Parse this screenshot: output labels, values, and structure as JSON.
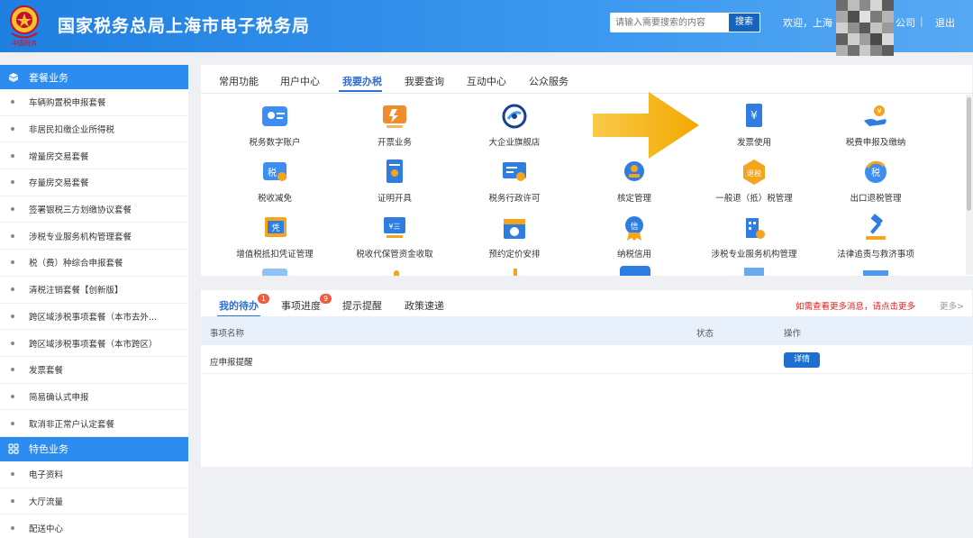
{
  "header": {
    "site_title": "国家税务总局上海市电子税务局",
    "search_placeholder": "请输入需要搜索的内容",
    "search_button": "搜索",
    "welcome": "欢迎，上海",
    "company_suffix": "公司",
    "separator": "|",
    "logout": "退出",
    "logo_text": "中国税务"
  },
  "sidebar": {
    "sections": [
      {
        "title": "套餐业务",
        "icon": "package-icon",
        "items": [
          "车辆购置税申报套餐",
          "非居民扣缴企业所得税",
          "增量房交易套餐",
          "存量房交易套餐",
          "签署银税三方划缴协议套餐",
          "涉税专业服务机构管理套餐",
          "税（费）种综合申报套餐",
          "清税注销套餐【创新版】",
          "跨区域涉税事项套餐（本市去外...",
          "跨区域涉税事项套餐（本市跨区）",
          "发票套餐",
          "简易确认式申报",
          "取消非正常户认定套餐"
        ]
      },
      {
        "title": "特色业务",
        "icon": "grid-icon",
        "items": [
          "电子资料",
          "大厅流量",
          "配送中心"
        ]
      }
    ]
  },
  "function_panel": {
    "tabs": [
      "常用功能",
      "用户中心",
      "我要办税",
      "我要查询",
      "互动中心",
      "公众服务"
    ],
    "active_tab": "我要办税",
    "rows": [
      [
        "税务数字账户",
        "开票业务",
        "大企业旗舰店",
        "",
        "发票使用",
        "税费申报及缴纳"
      ],
      [
        "税收减免",
        "证明开具",
        "税务行政许可",
        "核定管理",
        "一般退（抵）税管理",
        "出口退税管理"
      ],
      [
        "增值税抵扣凭证管理",
        "税收代保管资金收取",
        "预约定价安排",
        "纳税信用",
        "涉税专业服务机构管理",
        "法律追责与救济事项"
      ]
    ]
  },
  "todo_panel": {
    "tabs": [
      {
        "label": "我的待办",
        "badge": "1"
      },
      {
        "label": "事项进度",
        "badge": "9"
      },
      {
        "label": "提示提醒",
        "badge": ""
      },
      {
        "label": "政策速递",
        "badge": ""
      }
    ],
    "more_link": "如需查看更多消息，请点击更多",
    "more": "更多>",
    "columns": [
      "事项名称",
      "状态",
      "操作"
    ],
    "rows": [
      {
        "name": "应申报提醒",
        "status": "",
        "action": "详情"
      }
    ]
  },
  "colors": {
    "header_blue": "#2f8ae6",
    "accent_blue": "#2d6fd6",
    "badge_red": "#ef5b3b",
    "arrow_yellow": "#f6b81a"
  }
}
